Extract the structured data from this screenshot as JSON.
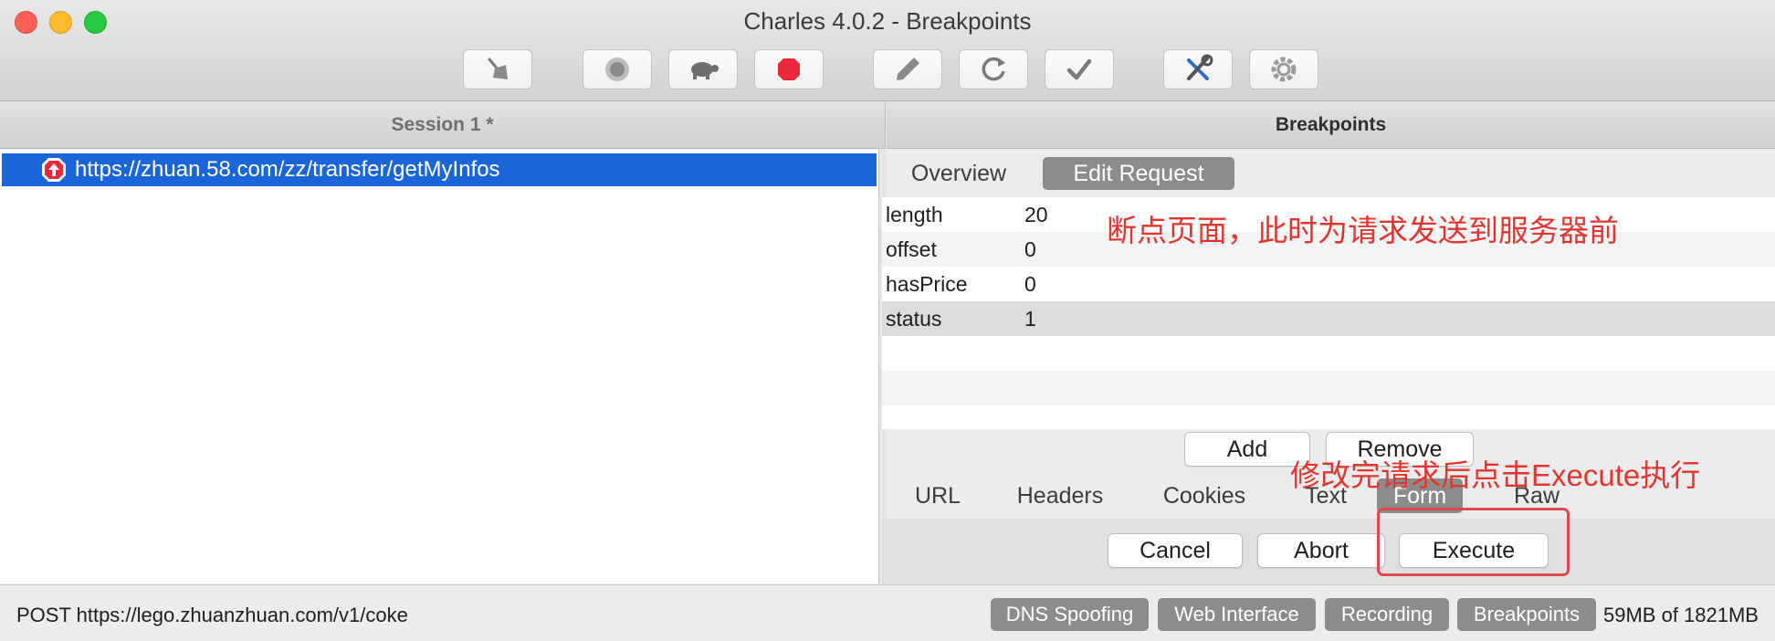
{
  "window": {
    "title": "Charles 4.0.2 - Breakpoints"
  },
  "toolbar": {
    "buttons": [
      {
        "icon": "broom-icon"
      },
      {
        "icon": "record-icon"
      },
      {
        "icon": "turtle-icon"
      },
      {
        "icon": "stop-sign-icon"
      },
      {
        "icon": "pen-icon"
      },
      {
        "icon": "refresh-icon"
      },
      {
        "icon": "checkmark-icon"
      },
      {
        "icon": "tools-icon"
      },
      {
        "icon": "gear-icon"
      }
    ]
  },
  "left_panel": {
    "header": "Session 1 *",
    "items": [
      {
        "url": "https://zhuan.58.com/zz/transfer/getMyInfos",
        "icon": "breakpoint-up-icon"
      }
    ]
  },
  "right_panel": {
    "header": "Breakpoints",
    "tabs": [
      "Overview",
      "Edit Request"
    ],
    "selected_tab": "Edit Request",
    "params": [
      {
        "name": "length",
        "value": "20"
      },
      {
        "name": "offset",
        "value": "0"
      },
      {
        "name": "hasPrice",
        "value": "0"
      },
      {
        "name": "status",
        "value": "1"
      }
    ],
    "add_label": "Add",
    "remove_label": "Remove",
    "bottom_tabs": [
      "URL",
      "Headers",
      "Cookies",
      "Text",
      "Form",
      "Raw"
    ],
    "selected_bottom_tab": "Form",
    "actions": {
      "cancel": "Cancel",
      "abort": "Abort",
      "execute": "Execute"
    }
  },
  "annotations": {
    "top": "断点页面，此时为请求发送到服务器前",
    "bottom": "修改完请求后点击Execute执行"
  },
  "statusbar": {
    "text": "POST https://lego.zhuanzhuan.com/v1/coke",
    "buttons": [
      "DNS Spoofing",
      "Web Interface",
      "Recording",
      "Breakpoints"
    ],
    "memory": "59MB of 1821MB"
  },
  "colors": {
    "selection": "#1a66d8",
    "annotation": "#e23530",
    "tab_selected": "#8c8c8c"
  }
}
